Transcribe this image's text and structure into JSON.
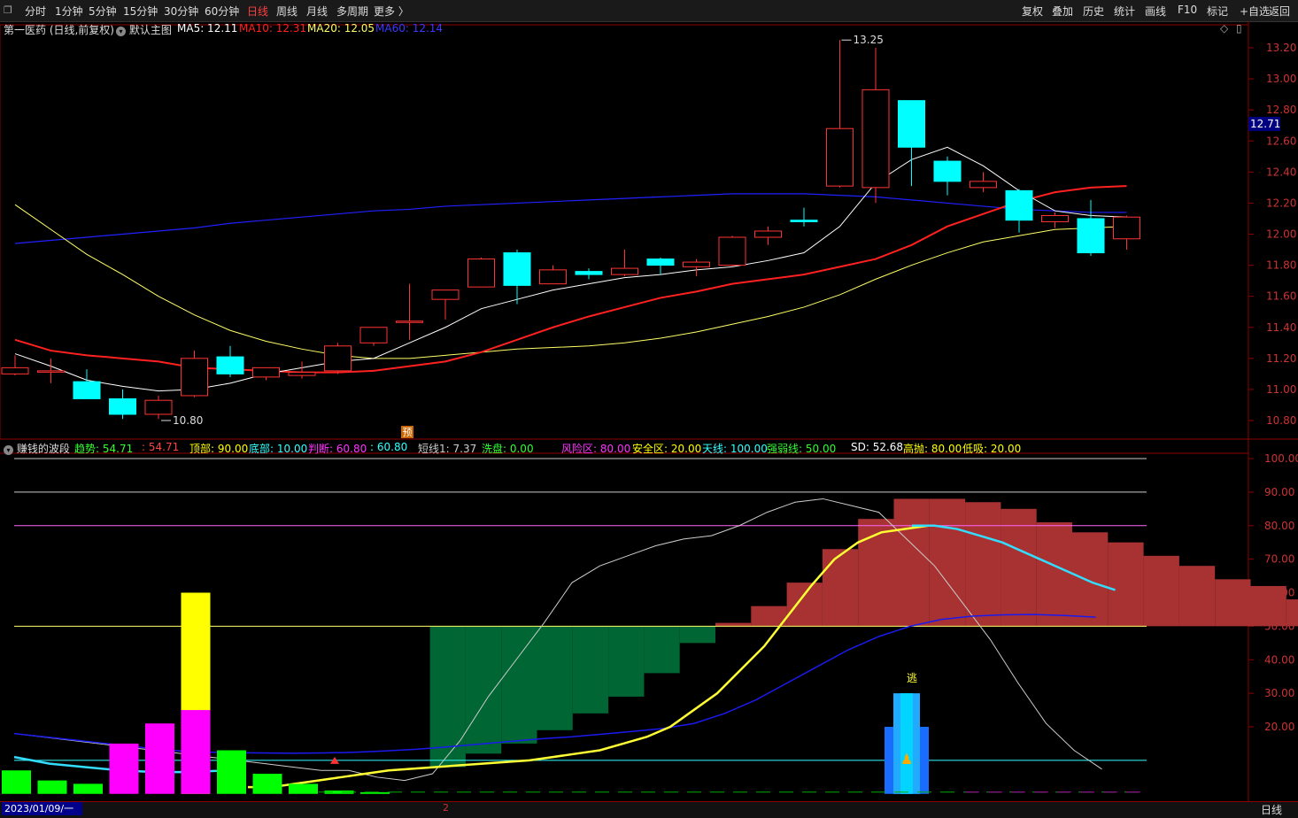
{
  "toolbar": {
    "periods": [
      "分时",
      "1分钟",
      "5分钟",
      "15分钟",
      "30分钟",
      "60分钟",
      "日线",
      "周线",
      "月线",
      "多周期",
      "更多 〉"
    ],
    "active_period": "日线",
    "right_buttons": [
      "复权",
      "叠加",
      "历史",
      "统计",
      "画线",
      "F10",
      "标记",
      "+自选",
      "返回"
    ]
  },
  "main_header": {
    "stock": "第一医药 (日线,前复权)",
    "template": "默认主图",
    "ma5_label": "MA5: 12.11",
    "ma10_label": "MA10: 12.31",
    "ma20_label": "MA20: 12.05",
    "ma60_label": "MA60: 12.14"
  },
  "sub_header": {
    "name": "赚钱的波段",
    "items": [
      {
        "text": "趋势: 54.71",
        "color": "#33ff33"
      },
      {
        "text": ": 54.71",
        "color": "#ff4444"
      },
      {
        "text": "顶部: 90.00",
        "color": "#ffff00"
      },
      {
        "text": "底部: 10.00",
        "color": "#33ffff"
      },
      {
        "text": "判断: 60.80",
        "color": "#ff33ff"
      },
      {
        "text": ": 60.80",
        "color": "#33ffff"
      },
      {
        "text": "短线1: 7.37",
        "color": "#cccccc"
      },
      {
        "text": "洗盘: 0.00",
        "color": "#33ff33"
      },
      {
        "text": "风险区: 80.00",
        "color": "#ff33ff"
      },
      {
        "text": "安全区: 20.00",
        "color": "#ffff00"
      },
      {
        "text": "天线: 100.00",
        "color": "#33ffff"
      },
      {
        "text": "强弱线: 50.00",
        "color": "#33ff33"
      },
      {
        "text": "SD: 52.68",
        "color": "#ffffff"
      },
      {
        "text": "高抛: 80.00",
        "color": "#ffff00"
      },
      {
        "text": "低吸: 20.00",
        "color": "#ffff00"
      }
    ]
  },
  "status": {
    "date": "2023/01/09/一",
    "period": "日线",
    "page_mark": "2"
  },
  "annotations": {
    "high": "13.25",
    "low": "10.80",
    "pre_mark": "预",
    "escape_mark": "逃",
    "price_tag": "12.71"
  },
  "colors": {
    "up": "#ff3333",
    "down": "#00ffff",
    "ma5": "#ffffff",
    "ma10": "#ff2020",
    "ma20": "#ffff66",
    "ma60": "#2020ff"
  },
  "chart_data": [
    {
      "type": "candlestick",
      "title": "第一医药 (日线,前复权)",
      "ylim": [
        10.75,
        13.3
      ],
      "yticks": [
        10.8,
        11.0,
        11.2,
        11.4,
        11.6,
        11.8,
        12.0,
        12.2,
        12.4,
        12.6,
        12.8,
        13.0,
        13.2
      ],
      "candles": [
        {
          "o": 11.1,
          "h": 11.22,
          "c": 11.14,
          "l": 11.09
        },
        {
          "o": 11.12,
          "h": 11.2,
          "c": 11.12,
          "l": 11.04
        },
        {
          "o": 11.05,
          "h": 11.13,
          "c": 10.94,
          "l": 10.94
        },
        {
          "o": 10.94,
          "h": 11.0,
          "c": 10.84,
          "l": 10.81
        },
        {
          "o": 10.84,
          "h": 10.96,
          "c": 10.93,
          "l": 10.81
        },
        {
          "o": 10.96,
          "h": 11.25,
          "c": 11.2,
          "l": 10.95
        },
        {
          "o": 11.21,
          "h": 11.28,
          "c": 11.1,
          "l": 11.08
        },
        {
          "o": 11.08,
          "h": 11.14,
          "c": 11.14,
          "l": 11.06
        },
        {
          "o": 11.09,
          "h": 11.18,
          "c": 11.11,
          "l": 11.07
        },
        {
          "o": 11.12,
          "h": 11.3,
          "c": 11.28,
          "l": 11.1
        },
        {
          "o": 11.3,
          "h": 11.4,
          "c": 11.4,
          "l": 11.28
        },
        {
          "o": 11.44,
          "h": 11.68,
          "c": 11.44,
          "l": 11.32
        },
        {
          "o": 11.58,
          "h": 11.64,
          "c": 11.64,
          "l": 11.45
        },
        {
          "o": 11.66,
          "h": 11.85,
          "c": 11.84,
          "l": 11.66
        },
        {
          "o": 11.88,
          "h": 11.9,
          "c": 11.67,
          "l": 11.55
        },
        {
          "o": 11.68,
          "h": 11.8,
          "c": 11.77,
          "l": 11.68
        },
        {
          "o": 11.76,
          "h": 11.78,
          "c": 11.74,
          "l": 11.71
        },
        {
          "o": 11.74,
          "h": 11.9,
          "c": 11.78,
          "l": 11.73
        },
        {
          "o": 11.84,
          "h": 11.85,
          "c": 11.8,
          "l": 11.74
        },
        {
          "o": 11.79,
          "h": 11.84,
          "c": 11.82,
          "l": 11.73
        },
        {
          "o": 11.8,
          "h": 11.99,
          "c": 11.98,
          "l": 11.79
        },
        {
          "o": 11.98,
          "h": 12.05,
          "c": 12.02,
          "l": 11.93
        },
        {
          "o": 12.09,
          "h": 12.17,
          "c": 12.08,
          "l": 12.05
        },
        {
          "o": 12.31,
          "h": 13.25,
          "c": 12.68,
          "l": 12.3
        },
        {
          "o": 12.3,
          "h": 13.2,
          "c": 12.93,
          "l": 12.2
        },
        {
          "o": 12.86,
          "h": 12.86,
          "c": 12.56,
          "l": 12.31
        },
        {
          "o": 12.47,
          "h": 12.5,
          "c": 12.34,
          "l": 12.25
        },
        {
          "o": 12.3,
          "h": 12.4,
          "c": 12.34,
          "l": 12.27
        },
        {
          "o": 12.28,
          "h": 12.29,
          "c": 12.09,
          "l": 12.01
        },
        {
          "o": 12.08,
          "h": 12.14,
          "c": 12.12,
          "l": 12.04
        },
        {
          "o": 12.1,
          "h": 12.22,
          "c": 11.88,
          "l": 11.86
        },
        {
          "o": 11.97,
          "h": 12.12,
          "c": 12.11,
          "l": 11.9
        }
      ],
      "ma5": [
        11.23,
        11.15,
        11.06,
        11.02,
        10.99,
        11.0,
        11.04,
        11.1,
        11.14,
        11.18,
        11.2,
        11.3,
        11.4,
        11.52,
        11.58,
        11.64,
        11.68,
        11.72,
        11.74,
        11.77,
        11.79,
        11.83,
        11.88,
        12.05,
        12.33,
        12.48,
        12.56,
        12.44,
        12.28,
        12.15,
        12.12,
        12.11
      ],
      "ma10": [
        11.32,
        11.25,
        11.22,
        11.2,
        11.18,
        11.14,
        11.13,
        11.12,
        11.11,
        11.11,
        11.12,
        11.15,
        11.18,
        11.24,
        11.32,
        11.4,
        11.47,
        11.53,
        11.59,
        11.63,
        11.68,
        11.71,
        11.74,
        11.79,
        11.84,
        11.93,
        12.05,
        12.13,
        12.21,
        12.27,
        12.3,
        12.31
      ],
      "ma20": [
        12.19,
        12.03,
        11.87,
        11.74,
        11.6,
        11.48,
        11.38,
        11.31,
        11.26,
        11.22,
        11.2,
        11.2,
        11.22,
        11.24,
        11.26,
        11.27,
        11.28,
        11.3,
        11.33,
        11.37,
        11.42,
        11.47,
        11.53,
        11.61,
        11.71,
        11.8,
        11.88,
        11.95,
        11.99,
        12.03,
        12.04,
        12.05
      ],
      "ma60": [
        11.94,
        11.96,
        11.98,
        12.0,
        12.02,
        12.04,
        12.07,
        12.09,
        12.11,
        12.13,
        12.15,
        12.16,
        12.18,
        12.19,
        12.2,
        12.21,
        12.22,
        12.23,
        12.24,
        12.25,
        12.26,
        12.26,
        12.26,
        12.25,
        12.24,
        12.22,
        12.2,
        12.18,
        12.16,
        12.15,
        12.14,
        12.14
      ]
    },
    {
      "type": "bar",
      "title": "赚钱的波段",
      "ylim": [
        0,
        103
      ],
      "yticks": [
        20,
        30,
        40,
        50,
        60,
        70,
        80,
        90,
        100
      ],
      "hlines": [
        {
          "value": 100,
          "color": "#cccccc"
        },
        {
          "value": 90,
          "color": "#cccccc"
        },
        {
          "value": 80,
          "color": "#ff66ff"
        },
        {
          "value": 50,
          "color": "#ffff66"
        },
        {
          "value": 10,
          "color": "#33ffff"
        }
      ],
      "trend_steps": [
        50,
        50,
        50,
        50,
        50,
        50,
        50,
        50,
        50,
        50,
        50,
        50,
        8,
        12,
        15,
        19,
        24,
        29,
        36,
        45,
        51,
        56,
        63,
        73,
        82,
        88,
        88,
        87,
        85,
        81,
        78,
        75,
        71,
        68,
        64,
        62,
        58,
        55,
        55,
        54.71
      ],
      "short_line": [
        18,
        17,
        16,
        15,
        14,
        13,
        12,
        11,
        10,
        9,
        8,
        7,
        7,
        5,
        4,
        6,
        16,
        29,
        40,
        51,
        63,
        68,
        71,
        74,
        76,
        77,
        80,
        84,
        87,
        88,
        86,
        84,
        76,
        68,
        57,
        46,
        33,
        21,
        13,
        7.37
      ],
      "yellow_line": [
        2,
        2,
        3,
        4,
        5,
        6,
        7,
        7.5,
        8,
        8.5,
        9,
        9.5,
        10,
        11,
        12,
        13,
        15,
        17,
        20,
        25,
        30,
        37,
        44,
        53,
        62,
        70,
        75,
        78,
        79,
        80
      ],
      "blue_line": [
        18,
        17,
        16,
        15,
        14,
        13,
        12.5,
        12.3,
        12.2,
        12.1,
        12.2,
        12.4,
        12.8,
        13.3,
        14,
        14.8,
        15.6,
        16.4,
        17,
        17.8,
        18.6,
        19.5,
        21,
        24,
        28,
        33,
        38,
        43,
        47,
        50,
        52,
        53,
        53.4,
        53.5,
        53.2,
        52.7
      ],
      "cyan_line": [
        80,
        80,
        79,
        77,
        75,
        72,
        69,
        66,
        63,
        60.8
      ],
      "washout_bars": [
        {
          "v": 7,
          "c": "#00ff00"
        },
        {
          "v": 4,
          "c": "#00ff00"
        },
        {
          "v": 3,
          "c": "#00ff00"
        },
        {
          "v": 15,
          "c": "#ff00ff"
        },
        {
          "v": 21,
          "c": "#ff00ff"
        },
        {
          "v": 60,
          "c": "#ffff00",
          "inner": 25,
          "innerc": "#ff00ff"
        },
        {
          "v": 13,
          "c": "#00ff00"
        },
        {
          "v": 6,
          "c": "#00ff00"
        },
        {
          "v": 3,
          "c": "#00ff00"
        },
        {
          "v": 1,
          "c": "#00ff00"
        },
        {
          "v": 0.5,
          "c": "#00ff00"
        }
      ],
      "escape_bar": {
        "v": 30,
        "inner": 20
      }
    }
  ]
}
